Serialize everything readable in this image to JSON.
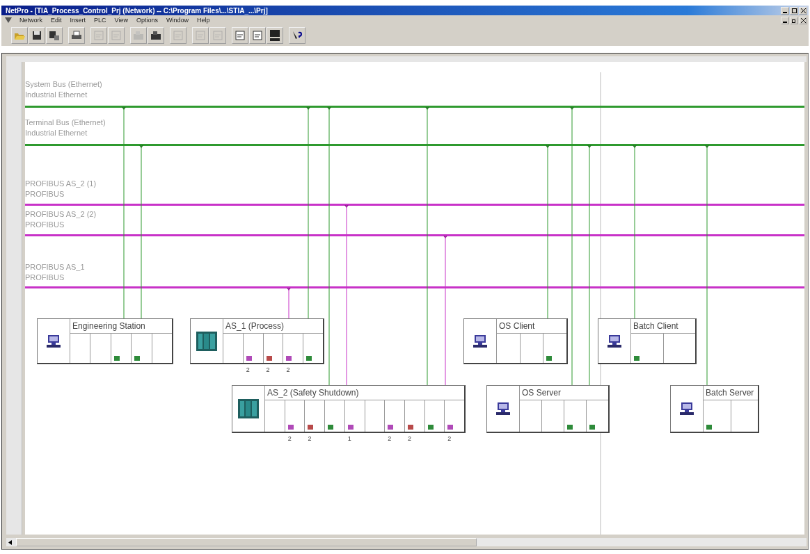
{
  "window": {
    "title": "NetPro - [TIA_Process_Control_Prj (Network) -- C:\\Program Files\\...\\STIA_...\\Prj]"
  },
  "menu": [
    "Network",
    "Edit",
    "Insert",
    "PLC",
    "View",
    "Options",
    "Window",
    "Help"
  ],
  "toolbar": [
    {
      "kind": "open",
      "disabled": false
    },
    {
      "kind": "save",
      "disabled": false
    },
    {
      "kind": "compile",
      "disabled": false
    },
    {
      "kind": "print",
      "disabled": false
    },
    {
      "kind": "copy",
      "disabled": true
    },
    {
      "kind": "paste",
      "disabled": true
    },
    {
      "kind": "upload",
      "disabled": true
    },
    {
      "kind": "download",
      "disabled": false
    },
    {
      "kind": "properties",
      "disabled": true
    },
    {
      "kind": "check",
      "disabled": true
    },
    {
      "kind": "check2",
      "disabled": true
    },
    {
      "kind": "catalog",
      "disabled": false
    },
    {
      "kind": "station",
      "disabled": false
    },
    {
      "kind": "consistency",
      "disabled": false
    },
    {
      "kind": "help",
      "disabled": false
    }
  ],
  "buses": [
    {
      "name": "System Bus (Ethernet)",
      "type": "Industrial Ethernet",
      "kind": "ethernet"
    },
    {
      "name": "Terminal Bus (Ethernet)",
      "type": "Industrial Ethernet",
      "kind": "ethernet"
    },
    {
      "name": "PROFIBUS AS_2 (1)",
      "type": "PROFIBUS",
      "kind": "profibus"
    },
    {
      "name": "PROFIBUS AS_2 (2)",
      "type": "PROFIBUS",
      "kind": "profibus"
    },
    {
      "name": "PROFIBUS AS_1",
      "type": "PROFIBUS",
      "kind": "profibus"
    }
  ],
  "nodes": [
    {
      "name": "Engineering Station",
      "kind": "pc",
      "slots": [
        {
          "kind": "empty"
        },
        {
          "kind": "empty"
        },
        {
          "kind": "port",
          "color": "#2e8b3a"
        },
        {
          "kind": "port",
          "color": "#2e8b3a"
        },
        {
          "kind": "empty"
        }
      ]
    },
    {
      "name": "AS_1 (Process)",
      "kind": "plc",
      "slots": [
        {
          "kind": "empty"
        },
        {
          "kind": "port",
          "color": "#b04ab8",
          "port": "2"
        },
        {
          "kind": "port",
          "color": "#b84a4a",
          "port": "2"
        },
        {
          "kind": "port",
          "color": "#b04ab8",
          "port": "2"
        },
        {
          "kind": "port",
          "color": "#2e8b3a"
        }
      ]
    },
    {
      "name": "OS Client",
      "kind": "pc",
      "slots": [
        {
          "kind": "empty"
        },
        {
          "kind": "empty"
        },
        {
          "kind": "port",
          "color": "#2e8b3a"
        }
      ]
    },
    {
      "name": "Batch Client",
      "kind": "pc",
      "slots": [
        {
          "kind": "port",
          "color": "#2e8b3a"
        },
        {
          "kind": "empty"
        }
      ]
    },
    {
      "name": "AS_2 (Safety Shutdown)",
      "kind": "plc",
      "slots": [
        {
          "kind": "empty"
        },
        {
          "kind": "port",
          "color": "#b04ab8",
          "port": "2"
        },
        {
          "kind": "port",
          "color": "#b84a4a",
          "port": "2"
        },
        {
          "kind": "port",
          "color": "#2e8b3a"
        },
        {
          "kind": "port",
          "color": "#b04ab8",
          "port": "1"
        },
        {
          "kind": "empty"
        },
        {
          "kind": "port",
          "color": "#b04ab8",
          "port": "2"
        },
        {
          "kind": "port",
          "color": "#b84a4a",
          "port": "2"
        },
        {
          "kind": "port",
          "color": "#2e8b3a"
        },
        {
          "kind": "port",
          "color": "#b04ab8",
          "port": "2"
        }
      ]
    },
    {
      "name": "OS Server",
      "kind": "pc",
      "slots": [
        {
          "kind": "empty"
        },
        {
          "kind": "empty"
        },
        {
          "kind": "port",
          "color": "#2e8b3a"
        },
        {
          "kind": "port",
          "color": "#2e8b3a"
        }
      ]
    },
    {
      "name": "Batch Server",
      "kind": "pc",
      "slots": [
        {
          "kind": "port",
          "color": "#2e8b3a"
        },
        {
          "kind": "empty"
        }
      ]
    }
  ]
}
